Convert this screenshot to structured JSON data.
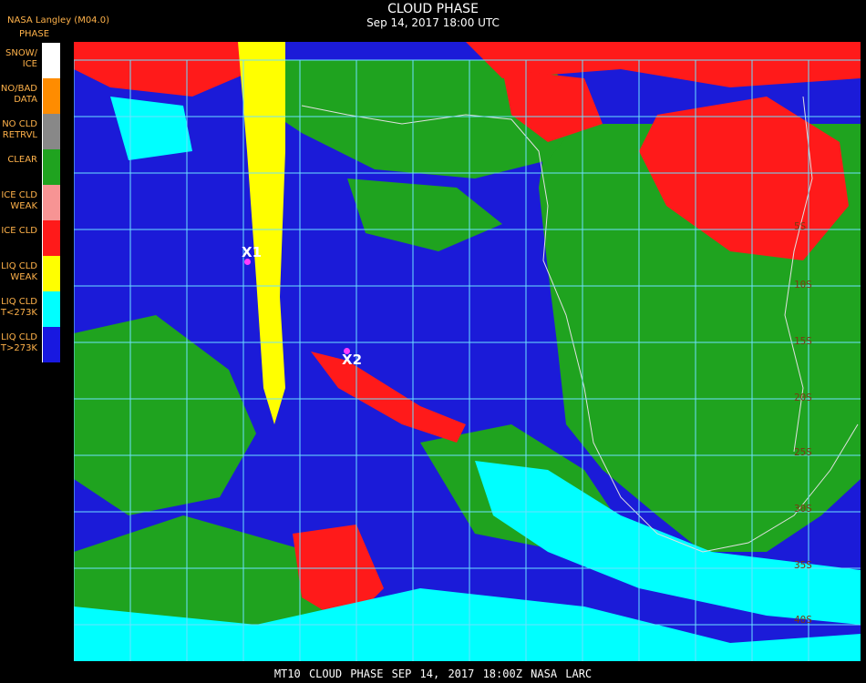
{
  "header": {
    "title": "CLOUD PHASE",
    "subtitle": "Sep 14, 2017 18:00 UTC",
    "provider": "NASA Langley (M04.0)"
  },
  "legend": {
    "title": "PHASE",
    "items": [
      {
        "label": "SNOW/\nICE",
        "color": "#ffffff"
      },
      {
        "label": "NO/BAD\nDATA",
        "color": "#ff8c00"
      },
      {
        "label": "NO CLD\nRETRVL",
        "color": "#888888"
      },
      {
        "label": "CLEAR",
        "color": "#1fa31f"
      },
      {
        "label": "ICE CLD\nWEAK",
        "color": "#f79494"
      },
      {
        "label": "ICE CLD",
        "color": "#ff1a1a"
      },
      {
        "label": "LIQ CLD\nWEAK",
        "color": "#ffff00"
      },
      {
        "label": "LIQ CLD\nT<273K",
        "color": "#00ffff"
      },
      {
        "label": "LIQ CLD\nT>273K",
        "color": "#1818e0"
      }
    ]
  },
  "map": {
    "grid_color": "#6ce0ff",
    "coast_color": "#e0e0e0",
    "latitude_labels": [
      "5S",
      "10S",
      "15S",
      "20S",
      "25S",
      "30S",
      "35S",
      "40S"
    ],
    "markers": [
      {
        "label": "X1",
        "color": "#ff3cff"
      },
      {
        "label": "X2",
        "color": "#ff3cff"
      }
    ]
  },
  "footer": {
    "text": "MT10   CLOUD PHASE   SEP 14, 2017 18:00Z   NASA LARC"
  }
}
